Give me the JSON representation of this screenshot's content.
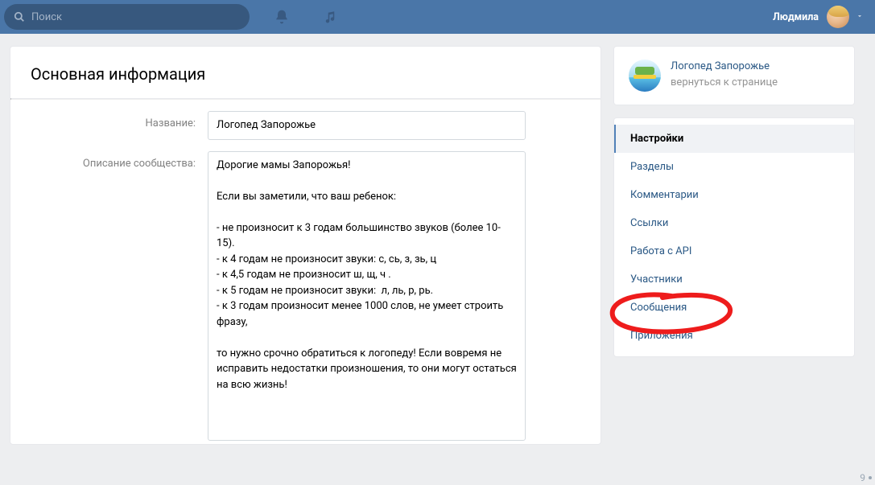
{
  "topbar": {
    "search_placeholder": "Поиск",
    "user_name": "Людмила"
  },
  "main": {
    "title": "Основная информация",
    "name_label": "Название:",
    "name_value": "Логопед Запорожье",
    "desc_label": "Описание сообщества:",
    "desc_value": "Дорогие мамы Запорожья!\n\nЕсли вы заметили, что ваш ребенок:\n\n- не произносит к 3 годам большинство звуков (более 10-15).\n- к 4 годам не произносит звуки: с, сь, з, зь, ц\n- к 4,5 годам не произносит ш, щ, ч .\n- к 5 годам не произносит звуки:  л, ль, р, рь.\n- к 3 годам произносит менее 1000 слов, не умеет строить фразу,\n\nто нужно срочно обратиться к логопеду! Если вовремя не исправить недостатки произношения, то они могут остаться на всю жизнь!"
  },
  "sidebar": {
    "group_title": "Логопед Запорожье",
    "group_sub": "вернуться к странице",
    "menu": [
      {
        "label": "Настройки",
        "active": true
      },
      {
        "label": "Разделы",
        "active": false
      },
      {
        "label": "Комментарии",
        "active": false
      },
      {
        "label": "Ссылки",
        "active": false
      },
      {
        "label": "Работа с API",
        "active": false
      },
      {
        "label": "Участники",
        "active": false
      },
      {
        "label": "Сообщения",
        "active": false
      },
      {
        "label": "Приложения",
        "active": false
      }
    ]
  },
  "notif_count": "9"
}
